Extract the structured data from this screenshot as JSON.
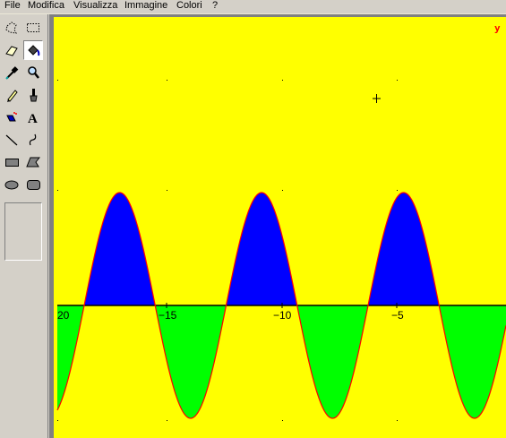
{
  "menubar": {
    "items": [
      "File",
      "Modifica",
      "Visualizza",
      "Immagine",
      "Colori",
      "?"
    ]
  },
  "toolbox": {
    "tools": [
      "free-form-select",
      "rectangle-select",
      "eraser",
      "fill-with-color",
      "pick-color",
      "magnifier",
      "pencil",
      "brush",
      "airbrush",
      "text",
      "line",
      "curve",
      "rectangle",
      "polygon",
      "ellipse",
      "rounded-rectangle"
    ],
    "selected": "fill-with-color"
  },
  "plot": {
    "y_axis_label": "y",
    "tick_labels": [
      "20",
      "−15",
      "−10",
      "−5"
    ],
    "colors": {
      "background": "#ffff00",
      "positive_fill": "#0000ff",
      "negative_fill": "#00ff00",
      "curve": "#ff0000",
      "axis": "#000000"
    }
  }
}
